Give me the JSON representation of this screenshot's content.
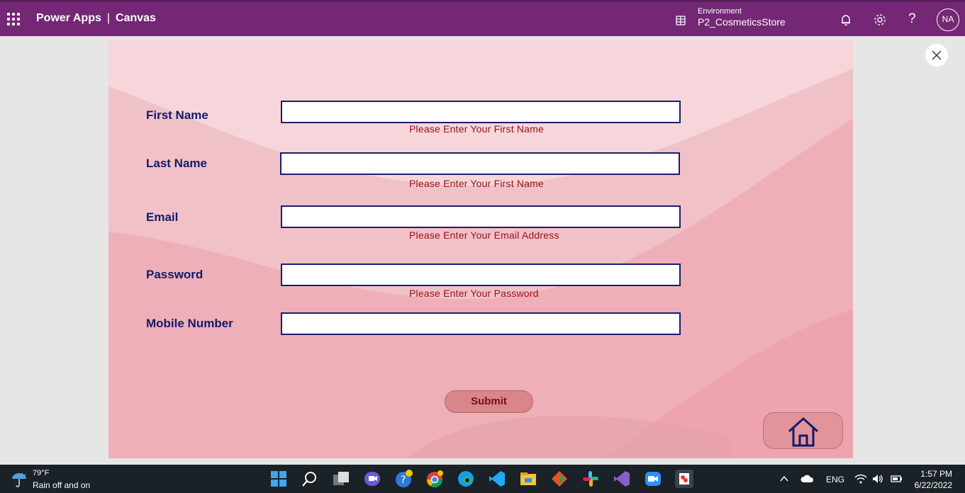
{
  "topbar": {
    "app_name": "Power Apps",
    "separator": "|",
    "mode": "Canvas",
    "environment_label": "Environment",
    "environment_value": "P2_CosmeticsStore",
    "avatar_initials": "NA",
    "help_glyph": "?",
    "color": "#742774"
  },
  "form": {
    "fields": [
      {
        "label": "First Name",
        "value": "",
        "error": "Please Enter Your First Name"
      },
      {
        "label": "Last Name",
        "value": "",
        "error": "Please Enter Your First Name"
      },
      {
        "label": "Email",
        "value": "",
        "error": "Please Enter Your Email Address"
      },
      {
        "label": "Password",
        "value": "",
        "error": "Please Enter Your Password"
      },
      {
        "label": "Mobile Number",
        "value": ""
      }
    ],
    "submit_label": "Submit",
    "home_icon": "home-icon"
  },
  "taskbar": {
    "weather_temp": "79°F",
    "weather_desc": "Rain off and on",
    "language": "ENG",
    "time": "1:57 PM",
    "date": "6/22/2022"
  },
  "colors": {
    "label": "#141a6b",
    "error": "#9b1015",
    "canvas_bg": "#f4d3d7",
    "button": "#d8868a"
  }
}
